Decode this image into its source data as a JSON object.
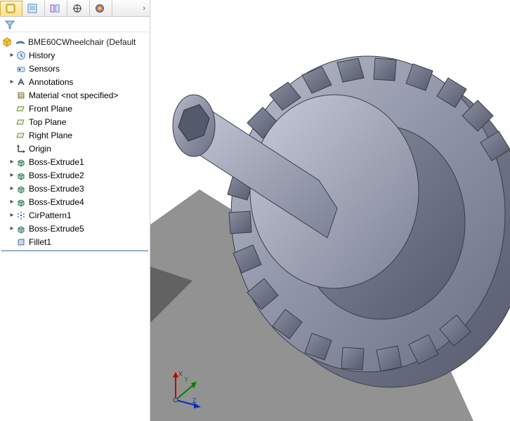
{
  "tabs": [
    {
      "name": "feature-manager-tab",
      "icon": "feature-manager-icon",
      "active": true
    },
    {
      "name": "property-manager-tab",
      "icon": "property-manager-icon",
      "active": false
    },
    {
      "name": "configuration-manager-tab",
      "icon": "configuration-manager-icon",
      "active": false
    },
    {
      "name": "dimxpert-manager-tab",
      "icon": "dimxpert-icon",
      "active": false
    },
    {
      "name": "display-manager-tab",
      "icon": "display-manager-icon",
      "active": false
    }
  ],
  "root": {
    "label": "BME60CWheelchair  (Default"
  },
  "tree": [
    {
      "name": "history",
      "label": "History",
      "icon": "history-icon",
      "expandable": true
    },
    {
      "name": "sensors",
      "label": "Sensors",
      "icon": "sensors-icon",
      "expandable": false
    },
    {
      "name": "annotations",
      "label": "Annotations",
      "icon": "annotations-icon",
      "expandable": true
    },
    {
      "name": "material",
      "label": "Material <not specified>",
      "icon": "material-icon",
      "expandable": false
    },
    {
      "name": "front-plane",
      "label": "Front Plane",
      "icon": "plane-icon",
      "expandable": false
    },
    {
      "name": "top-plane",
      "label": "Top Plane",
      "icon": "plane-icon",
      "expandable": false
    },
    {
      "name": "right-plane",
      "label": "Right Plane",
      "icon": "plane-icon",
      "expandable": false
    },
    {
      "name": "origin",
      "label": "Origin",
      "icon": "origin-icon",
      "expandable": false
    },
    {
      "name": "boss-extrude1",
      "label": "Boss-Extrude1",
      "icon": "extrude-icon",
      "expandable": true
    },
    {
      "name": "boss-extrude2",
      "label": "Boss-Extrude2",
      "icon": "extrude-icon",
      "expandable": true
    },
    {
      "name": "boss-extrude3",
      "label": "Boss-Extrude3",
      "icon": "extrude-icon",
      "expandable": true
    },
    {
      "name": "boss-extrude4",
      "label": "Boss-Extrude4",
      "icon": "extrude-icon",
      "expandable": true
    },
    {
      "name": "cirpattern1",
      "label": "CirPattern1",
      "icon": "pattern-icon",
      "expandable": true
    },
    {
      "name": "boss-extrude5",
      "label": "Boss-Extrude5",
      "icon": "extrude-icon",
      "expandable": true
    },
    {
      "name": "fillet1",
      "label": "Fillet1",
      "icon": "fillet-icon",
      "expandable": false
    }
  ],
  "triad": {
    "x": "X",
    "y": "Y",
    "z": "Z"
  },
  "chevron": "›"
}
